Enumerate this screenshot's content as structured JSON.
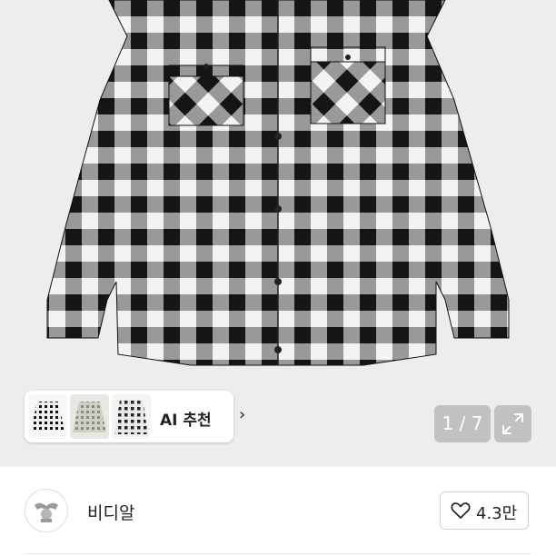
{
  "product": {
    "image_alt": "black and white buffalo check flannel shirt",
    "image_counter": "1 / 7"
  },
  "ai_recommend": {
    "label": "AI 추천",
    "chevron": "›",
    "thumbnails": [
      "checked-shirt-thumb",
      "grey-check-shirt-thumb",
      "check-shirt-thumb"
    ]
  },
  "seller": {
    "name": "비디알",
    "likes": "4.3만"
  },
  "colors": {
    "check_dark": "#1a1a1a",
    "check_light": "#f3f3f3",
    "check_mid": "#7a7a7a"
  },
  "icons": {
    "expand": "expand-icon",
    "heart": "heart-icon"
  }
}
